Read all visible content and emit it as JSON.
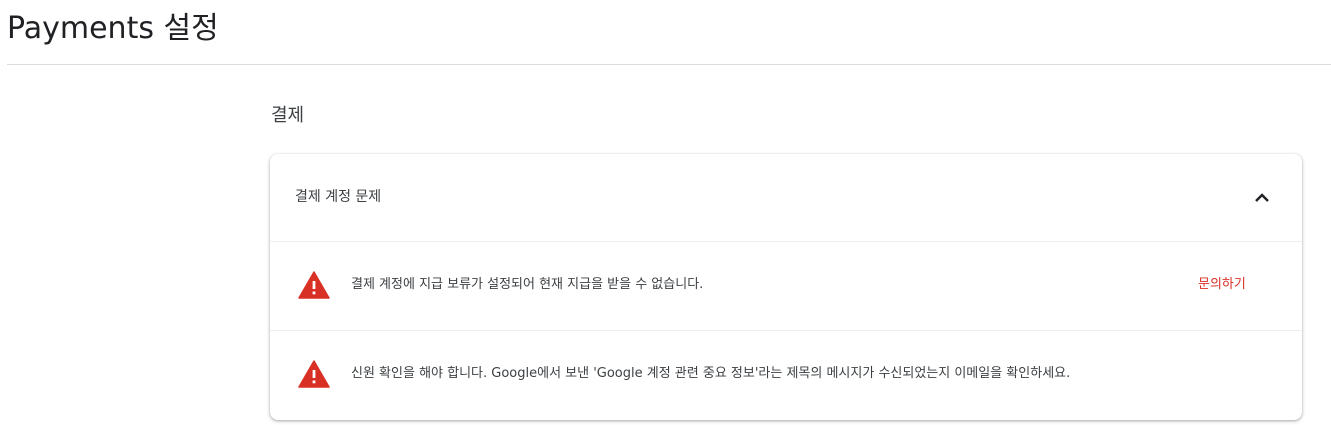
{
  "header": {
    "title": "Payments 설정"
  },
  "section": {
    "title": "결제"
  },
  "card": {
    "title": "결제 계정 문제",
    "collapse_icon": "chevron-up-icon",
    "alerts": [
      {
        "icon": "warning-icon",
        "text": "결제 계정에 지급 보류가 설정되어 현재 지급을 받을 수 없습니다.",
        "action_label": "문의하기"
      },
      {
        "icon": "warning-icon",
        "text": "신원 확인을 해야 합니다. Google에서 보낸 'Google 계정 관련 중요 정보'라는 제목의 메시지가 수신되었는지 이메일을 확인하세요."
      }
    ]
  },
  "colors": {
    "warning": "#d93025",
    "link": "#d93025",
    "text": "#3c4043",
    "divider": "#dadce0"
  }
}
